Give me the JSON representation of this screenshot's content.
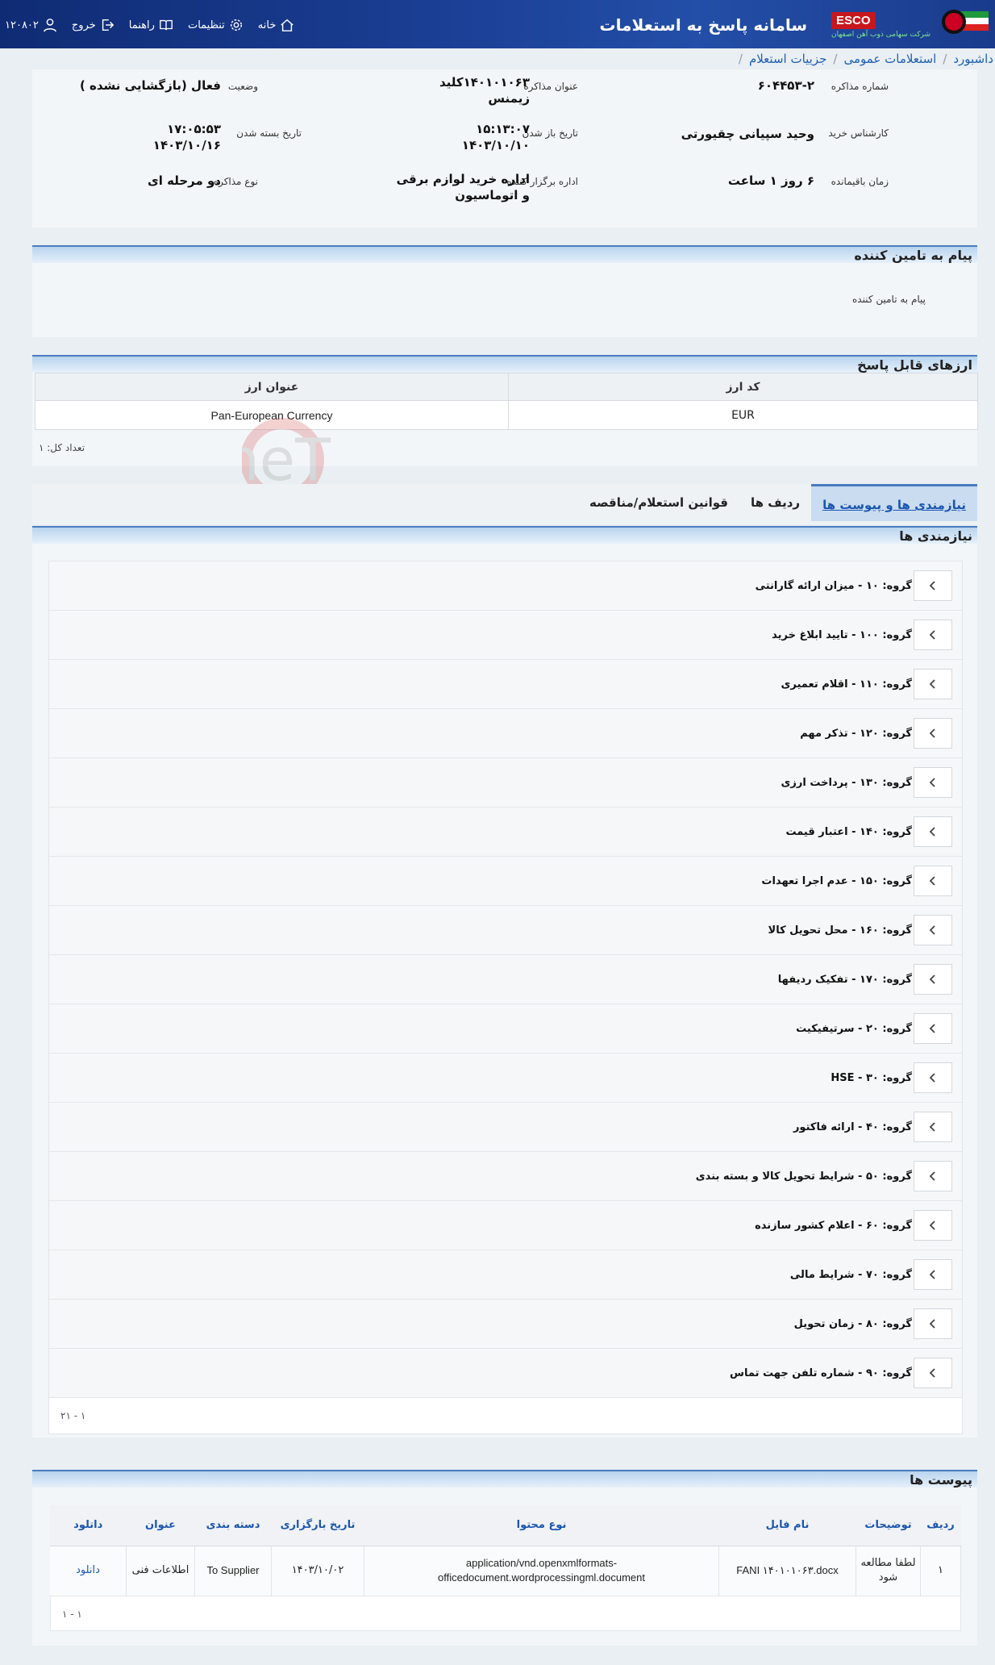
{
  "header": {
    "brand_logo": "ESCO",
    "brand_sub": "شرکت سهامی ذوب آهن اصفهان",
    "title": "سامانه پاسخ به استعلامات",
    "nav": [
      {
        "label": "خانه",
        "icon": "home-icon"
      },
      {
        "label": "تنظیمات",
        "icon": "gear-icon"
      },
      {
        "label": "راهنما",
        "icon": "book-icon"
      },
      {
        "label": "خروج",
        "icon": "logout-icon"
      },
      {
        "label": "۱۲۰۸۰۲",
        "icon": "user-icon"
      }
    ]
  },
  "breadcrumb": [
    "داشبورد",
    "استعلامات عمومی",
    "جزییات استعلام"
  ],
  "info": {
    "num_label": "شماره مذاکره",
    "num_value": "۶۰۴۴۵۳-۲",
    "title_label": "عنوان مذاکره",
    "title_value": "۱۴۰۱۰۱۰۶۳کلید زیمنس",
    "status_label": "وضعیت",
    "status_value": "فعال (بازگشایی نشده )",
    "buyer_label": "کارشناس خرید",
    "buyer_value": "وحید سپیانی چقیورتی",
    "open_label": "تاریخ باز شدن",
    "open_time": "۱۵:۱۳:۰۷",
    "open_date": "۱۴۰۳/۱۰/۱۰",
    "close_label": "تاریخ بسته شدن",
    "close_time": "۱۷:۰۵:۵۳",
    "close_date": "۱۴۰۳/۱۰/۱۶",
    "remain_label": "زمان باقیمانده",
    "remain_value": "۶ روز ۱ ساعت",
    "dept_label": "اداره برگزار کننده",
    "dept_value": "اداره خرید لوازم برقی و اتوماسیون",
    "type_label": "نوع مذاکره",
    "type_value": "دو مرحله ای"
  },
  "message": {
    "heading": "پیام به تامین کننده",
    "body": "پیام به تامین کننده"
  },
  "currencies": {
    "heading": "ارزهای قابل پاسخ",
    "col_code": "کد ارز",
    "col_title": "عنوان ارز",
    "rows": [
      {
        "code": "EUR",
        "title": "Pan-European Currency"
      }
    ],
    "count": "تعداد کل: ۱"
  },
  "tabs": [
    "نیازمندی ها و پیوست ها",
    "ردیف ها",
    "قوانین استعلام/مناقصه"
  ],
  "requirements": {
    "heading": "نیازمندی ها",
    "groups": [
      "گروه: ۱۰ - میزان ارائه گارانتی",
      "گروه: ۱۰۰ - تایید ابلاغ خرید",
      "گروه: ۱۱۰ - اقلام تعمیری",
      "گروه: ۱۲۰ - تذکر مهم",
      "گروه: ۱۳۰ - پرداخت ارزی",
      "گروه: ۱۴۰ - اعتبار قیمت",
      "گروه: ۱۵۰ - عدم اجرا تعهدات",
      "گروه: ۱۶۰ - محل تحویل کالا",
      "گروه: ۱۷۰ - تفکیک ردیفها",
      "گروه: ۲۰ - سرتیفیکیت",
      "گروه: ۳۰ - HSE",
      "گروه: ۴۰ - ارائه فاکتور",
      "گروه: ۵۰ - شرایط تحویل کالا و بسته بندی",
      "گروه: ۶۰ - اعلام کشور سازنده",
      "گروه: ۷۰ - شرایط مالی",
      "گروه: ۸۰ - زمان تحویل",
      "گروه: ۹۰ - شماره تلفن جهت تماس"
    ],
    "pager": "۱ - ۲۱"
  },
  "attachments": {
    "heading": "پیوست ها",
    "cols": [
      "ردیف",
      "توضیحات",
      "نام فایل",
      "نوع محتوا",
      "تاریخ بارگزاری",
      "دسته بندی",
      "عنوان",
      "داتلود"
    ],
    "rows": [
      {
        "idx": "۱",
        "desc": "لطفا مطالعه شود",
        "file": "FANI ۱۴۰۱۰۱۰۶۳.docx",
        "mime": "application/vnd.openxmlformats-officedocument.wordprocessingml.document",
        "date": "۱۴۰۳/۱۰/۰۲",
        "category": "To Supplier",
        "title": "اطلاعات فنی",
        "download": "دانلود"
      }
    ],
    "pager": "۱ - ۱"
  },
  "watermark": "AriaTender.neT"
}
